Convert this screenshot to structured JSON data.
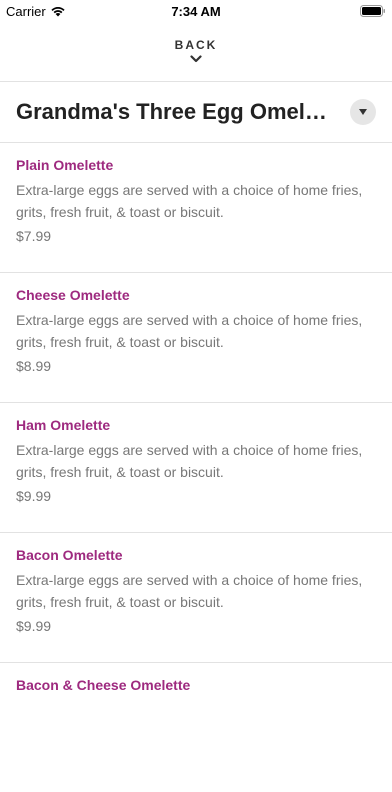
{
  "status": {
    "carrier": "Carrier",
    "time": "7:34 AM"
  },
  "nav": {
    "back_label": "BACK"
  },
  "category": {
    "title": "Grandma's Three Egg Omelett..."
  },
  "items": [
    {
      "name": "Plain Omelette",
      "description": "Extra-large eggs are served with a choice of home fries, grits, fresh fruit, & toast or biscuit.",
      "price": "$7.99"
    },
    {
      "name": "Cheese Omelette",
      "description": "Extra-large eggs are served with a choice of home fries, grits, fresh fruit, & toast or biscuit.",
      "price": "$8.99"
    },
    {
      "name": "Ham Omelette",
      "description": "Extra-large eggs are served with a choice of home fries, grits, fresh fruit, & toast or biscuit.",
      "price": "$9.99"
    },
    {
      "name": "Bacon Omelette",
      "description": "Extra-large eggs are served with a choice of home fries, grits, fresh fruit, & toast or biscuit.",
      "price": "$9.99"
    },
    {
      "name": "Bacon & Cheese Omelette",
      "description": "",
      "price": ""
    }
  ],
  "colors": {
    "item_name": "#9e2a7f",
    "text_muted": "#777777",
    "divider": "#e2e2e2"
  },
  "icons": {
    "wifi": "wifi-icon",
    "battery": "battery-icon",
    "back": "chevron-down-icon",
    "dropdown": "dropdown-triangle-icon"
  }
}
